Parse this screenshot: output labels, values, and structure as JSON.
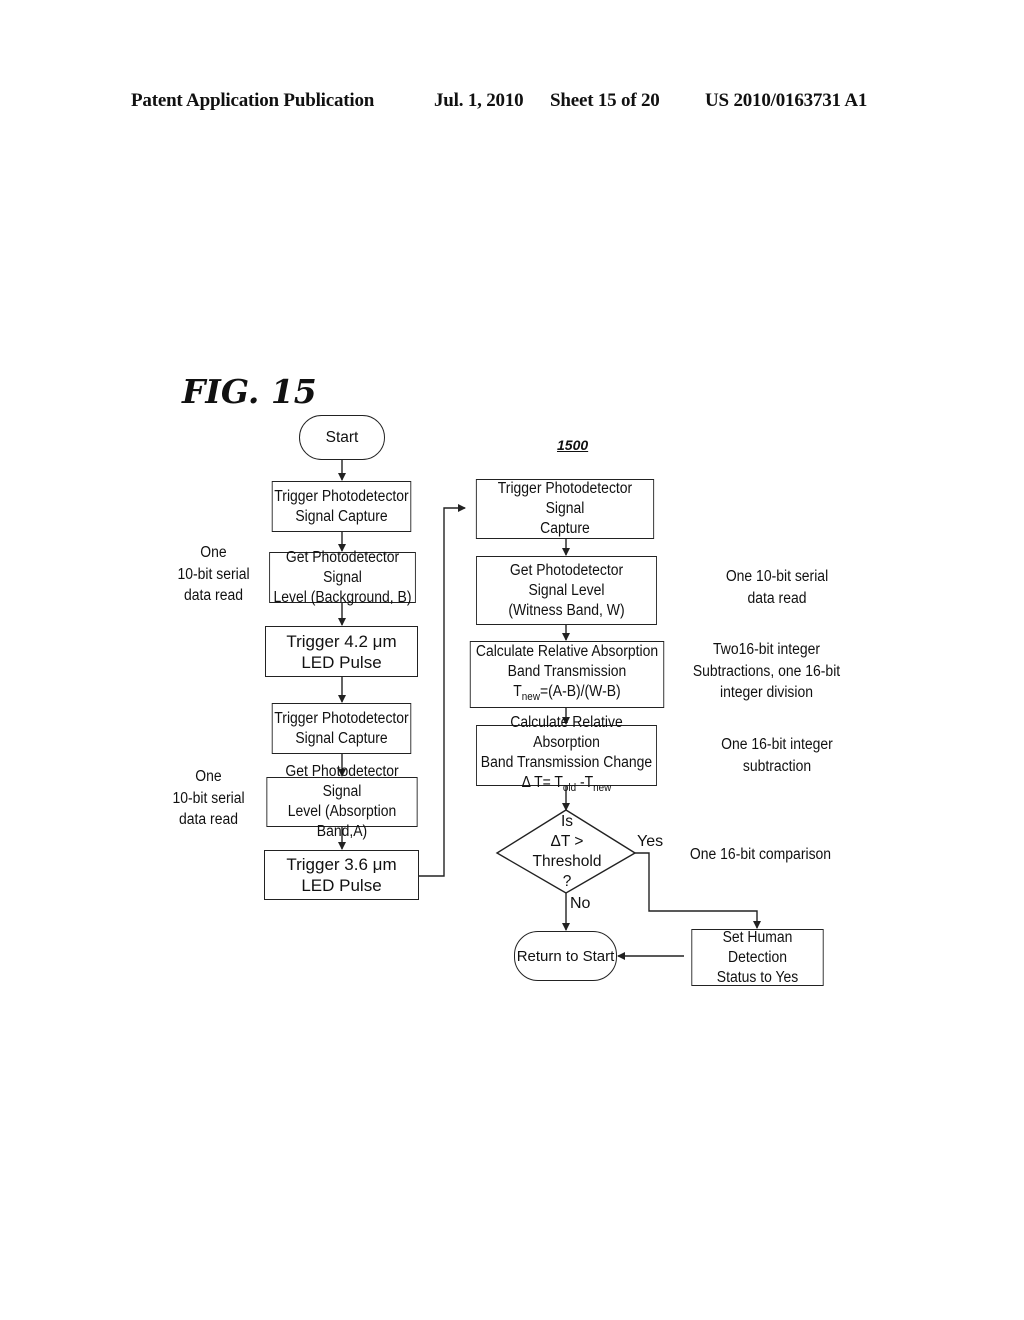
{
  "header": {
    "publication": "Patent Application Publication",
    "date": "Jul. 1, 2010",
    "sheet": "Sheet 15 of 20",
    "number": "US 2010/0163731 A1"
  },
  "figure": {
    "title": "FIG. 15",
    "reference": "1500"
  },
  "left_column": {
    "start": "Start",
    "steps": [
      {
        "line1": "Trigger Photodetector",
        "line2": "Signal Capture"
      },
      {
        "line1": "Get Photodetector Signal",
        "line2": "Level (Background, B)"
      },
      {
        "line1": "Trigger 4.2 μm",
        "line2": "LED Pulse"
      },
      {
        "line1": "Trigger Photodetector",
        "line2": "Signal Capture"
      },
      {
        "line1": "Get Photodetector Signal",
        "line2": "Level (Absorption Band,A)"
      },
      {
        "line1": "Trigger 3.6 μm",
        "line2": "LED Pulse"
      }
    ],
    "notes": [
      {
        "line1": "One",
        "line2": "10-bit serial",
        "line3": "data read"
      },
      {
        "line1": "One",
        "line2": "10-bit serial",
        "line3": "data read"
      }
    ]
  },
  "right_column": {
    "steps": [
      {
        "line1": "Trigger Photodetector Signal",
        "line2": "Capture"
      },
      {
        "line1": "Get Photodetector",
        "line2": "Signal Level",
        "line3": "(Witness Band, W)"
      },
      {
        "line1": "Calculate Relative Absorption",
        "line2": "Band Transmission",
        "line3_var": "T",
        "line3_sub": "new",
        "line3_rest": "=(A-B)/(W-B)"
      },
      {
        "line1": "Calculate Relative Absorption",
        "line2": "Band Transmission Change",
        "line3_pre": "Δ T= T",
        "line3_sub1": "old",
        "line3_mid": " -T",
        "line3_sub2": "new"
      }
    ],
    "decision": {
      "line1": "Is",
      "line2": "ΔT >",
      "line3": "Threshold",
      "line4": "?",
      "yes": "Yes",
      "no": "No"
    },
    "return": "Return to Start",
    "set_status": {
      "line1": "Set Human Detection",
      "line2": "Status to Yes"
    },
    "notes": [
      {
        "line1": "One 10-bit serial",
        "line2": "data read"
      },
      {
        "line1": "Two16-bit integer",
        "line2": "Subtractions, one 16-bit",
        "line3": "integer division"
      },
      {
        "line1": "One 16-bit integer",
        "line2": "subtraction"
      },
      {
        "line1": "One 16-bit comparison"
      }
    ]
  }
}
